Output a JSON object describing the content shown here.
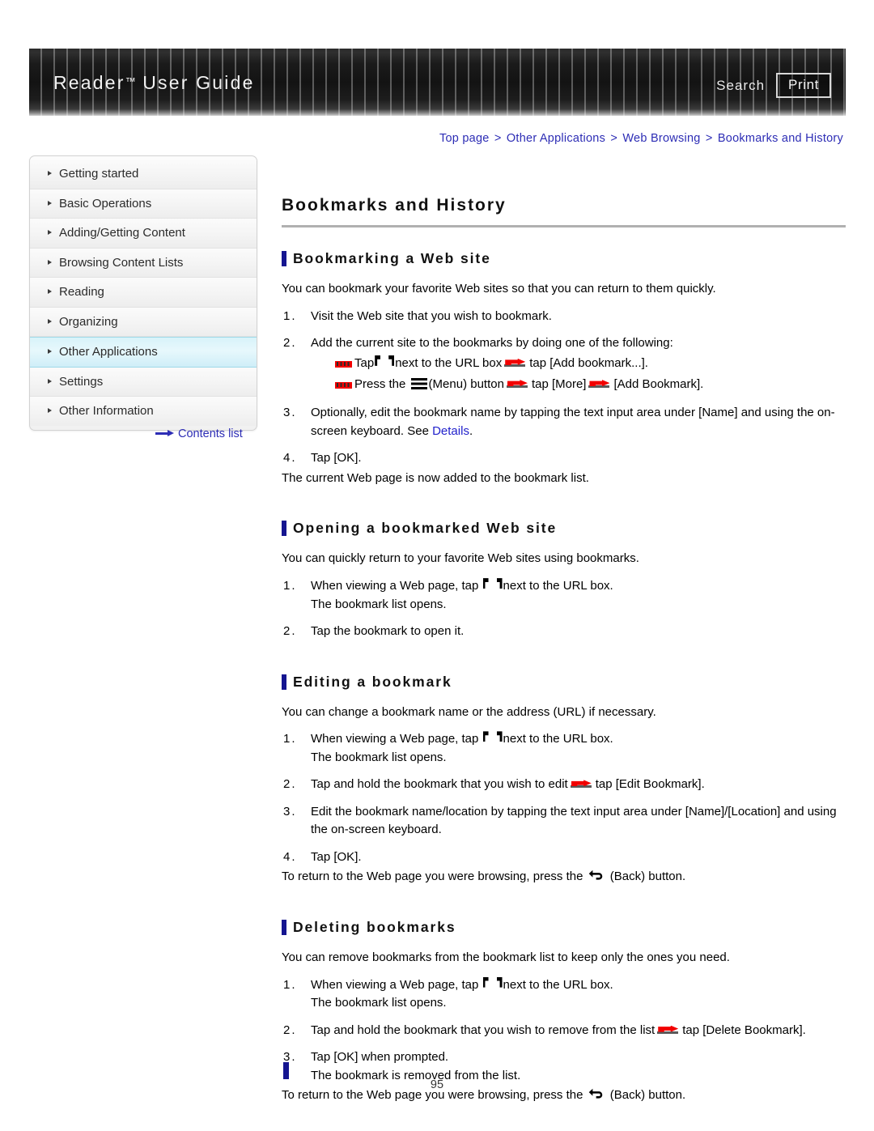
{
  "header": {
    "title": "Reader",
    "title_tm": "™",
    "title_rest": " User Guide",
    "search_label": "Search",
    "print_label": "Print"
  },
  "breadcrumb": {
    "items": [
      "Top page",
      "Other Applications",
      "Web Browsing",
      "Bookmarks and History"
    ],
    "separator": ">"
  },
  "sidebar": {
    "items": [
      {
        "label": "Getting started",
        "active": false
      },
      {
        "label": "Basic Operations",
        "active": false
      },
      {
        "label": "Adding/Getting Content",
        "active": false
      },
      {
        "label": "Browsing Content Lists",
        "active": false
      },
      {
        "label": "Reading",
        "active": false
      },
      {
        "label": "Organizing",
        "active": false
      },
      {
        "label": "Other Applications",
        "active": true
      },
      {
        "label": "Settings",
        "active": false
      },
      {
        "label": "Other Information",
        "active": false
      }
    ],
    "contents_link": "Contents list"
  },
  "main": {
    "page_title": "Bookmarks and History",
    "sections": [
      {
        "title": "Bookmarking a Web site",
        "intro": "You can bookmark your favorite Web sites so that you can return to them quickly.",
        "steps": [
          {
            "num": "1.",
            "text": "Visit the Web site that you wish to bookmark."
          },
          {
            "num": "2.",
            "text": "Add the current site to the bookmarks by doing one of the following:"
          }
        ],
        "sub_a_1": "Tap",
        "sub_a_2": "next to the URL box",
        "sub_a_3": "tap [Add bookmark...].",
        "sub_b_1": "Press the",
        "sub_b_2": "(Menu) button",
        "sub_b_3": "tap [More]",
        "sub_b_4": "[Add Bookmark].",
        "step3_pre": "Optionally, edit the bookmark name by tapping the text input area under [Name] and using the on-screen keyboard. See ",
        "step3_link": "Details",
        "step3_post": ".",
        "step3_num": "3.",
        "step4_num": "4.",
        "step4_text": "Tap [OK].",
        "tail": "The current Web page is now added to the bookmark list."
      },
      {
        "title": "Opening a bookmarked Web site",
        "intro": "You can quickly return to your favorite Web sites using bookmarks.",
        "step1_num": "1.",
        "step1_pre": "When viewing a Web page, tap",
        "step1_post": "next to the URL box.",
        "step1_sub": "The bookmark list opens.",
        "step2_num": "2.",
        "step2_text": "Tap the bookmark to open it."
      },
      {
        "title": "Editing a bookmark",
        "intro": "You can change a bookmark name or the address (URL) if necessary.",
        "step1_num": "1.",
        "step1_pre": "When viewing a Web page, tap",
        "step1_post": "next to the URL box.",
        "step1_sub": "The bookmark list opens.",
        "step2_num": "2.",
        "step2_pre": "Tap and hold the bookmark that you wish to edit",
        "step2_post": "tap [Edit Bookmark].",
        "step3_num": "3.",
        "step3_text": "Edit the bookmark name/location by tapping the text input area under [Name]/[Location] and using the on-screen keyboard.",
        "step4_num": "4.",
        "step4_text": "Tap [OK].",
        "tail_pre": "To return to the Web page you were browsing, press the",
        "tail_post": "(Back) button."
      },
      {
        "title": "Deleting bookmarks",
        "intro": "You can remove bookmarks from the bookmark list to keep only the ones you need.",
        "step1_num": "1.",
        "step1_pre": "When viewing a Web page, tap",
        "step1_post": "next to the URL box.",
        "step1_sub": "The bookmark list opens.",
        "step2_num": "2.",
        "step2_pre": "Tap and hold the bookmark that you wish to remove from the list",
        "step2_post": "tap [Delete Bookmark].",
        "step3_num": "3.",
        "step3_text": "Tap [OK] when prompted.",
        "step3_sub": "The bookmark is removed from the list.",
        "tail_pre": "To return to the Web page you were browsing, press the",
        "tail_post": "(Back) button."
      }
    ]
  },
  "footer": {
    "page_number": "95"
  },
  "colors": {
    "link": "#2d2db5",
    "accent_bar": "#151590",
    "highlight": "#d8f3fa",
    "icon_red": "#f20000"
  }
}
